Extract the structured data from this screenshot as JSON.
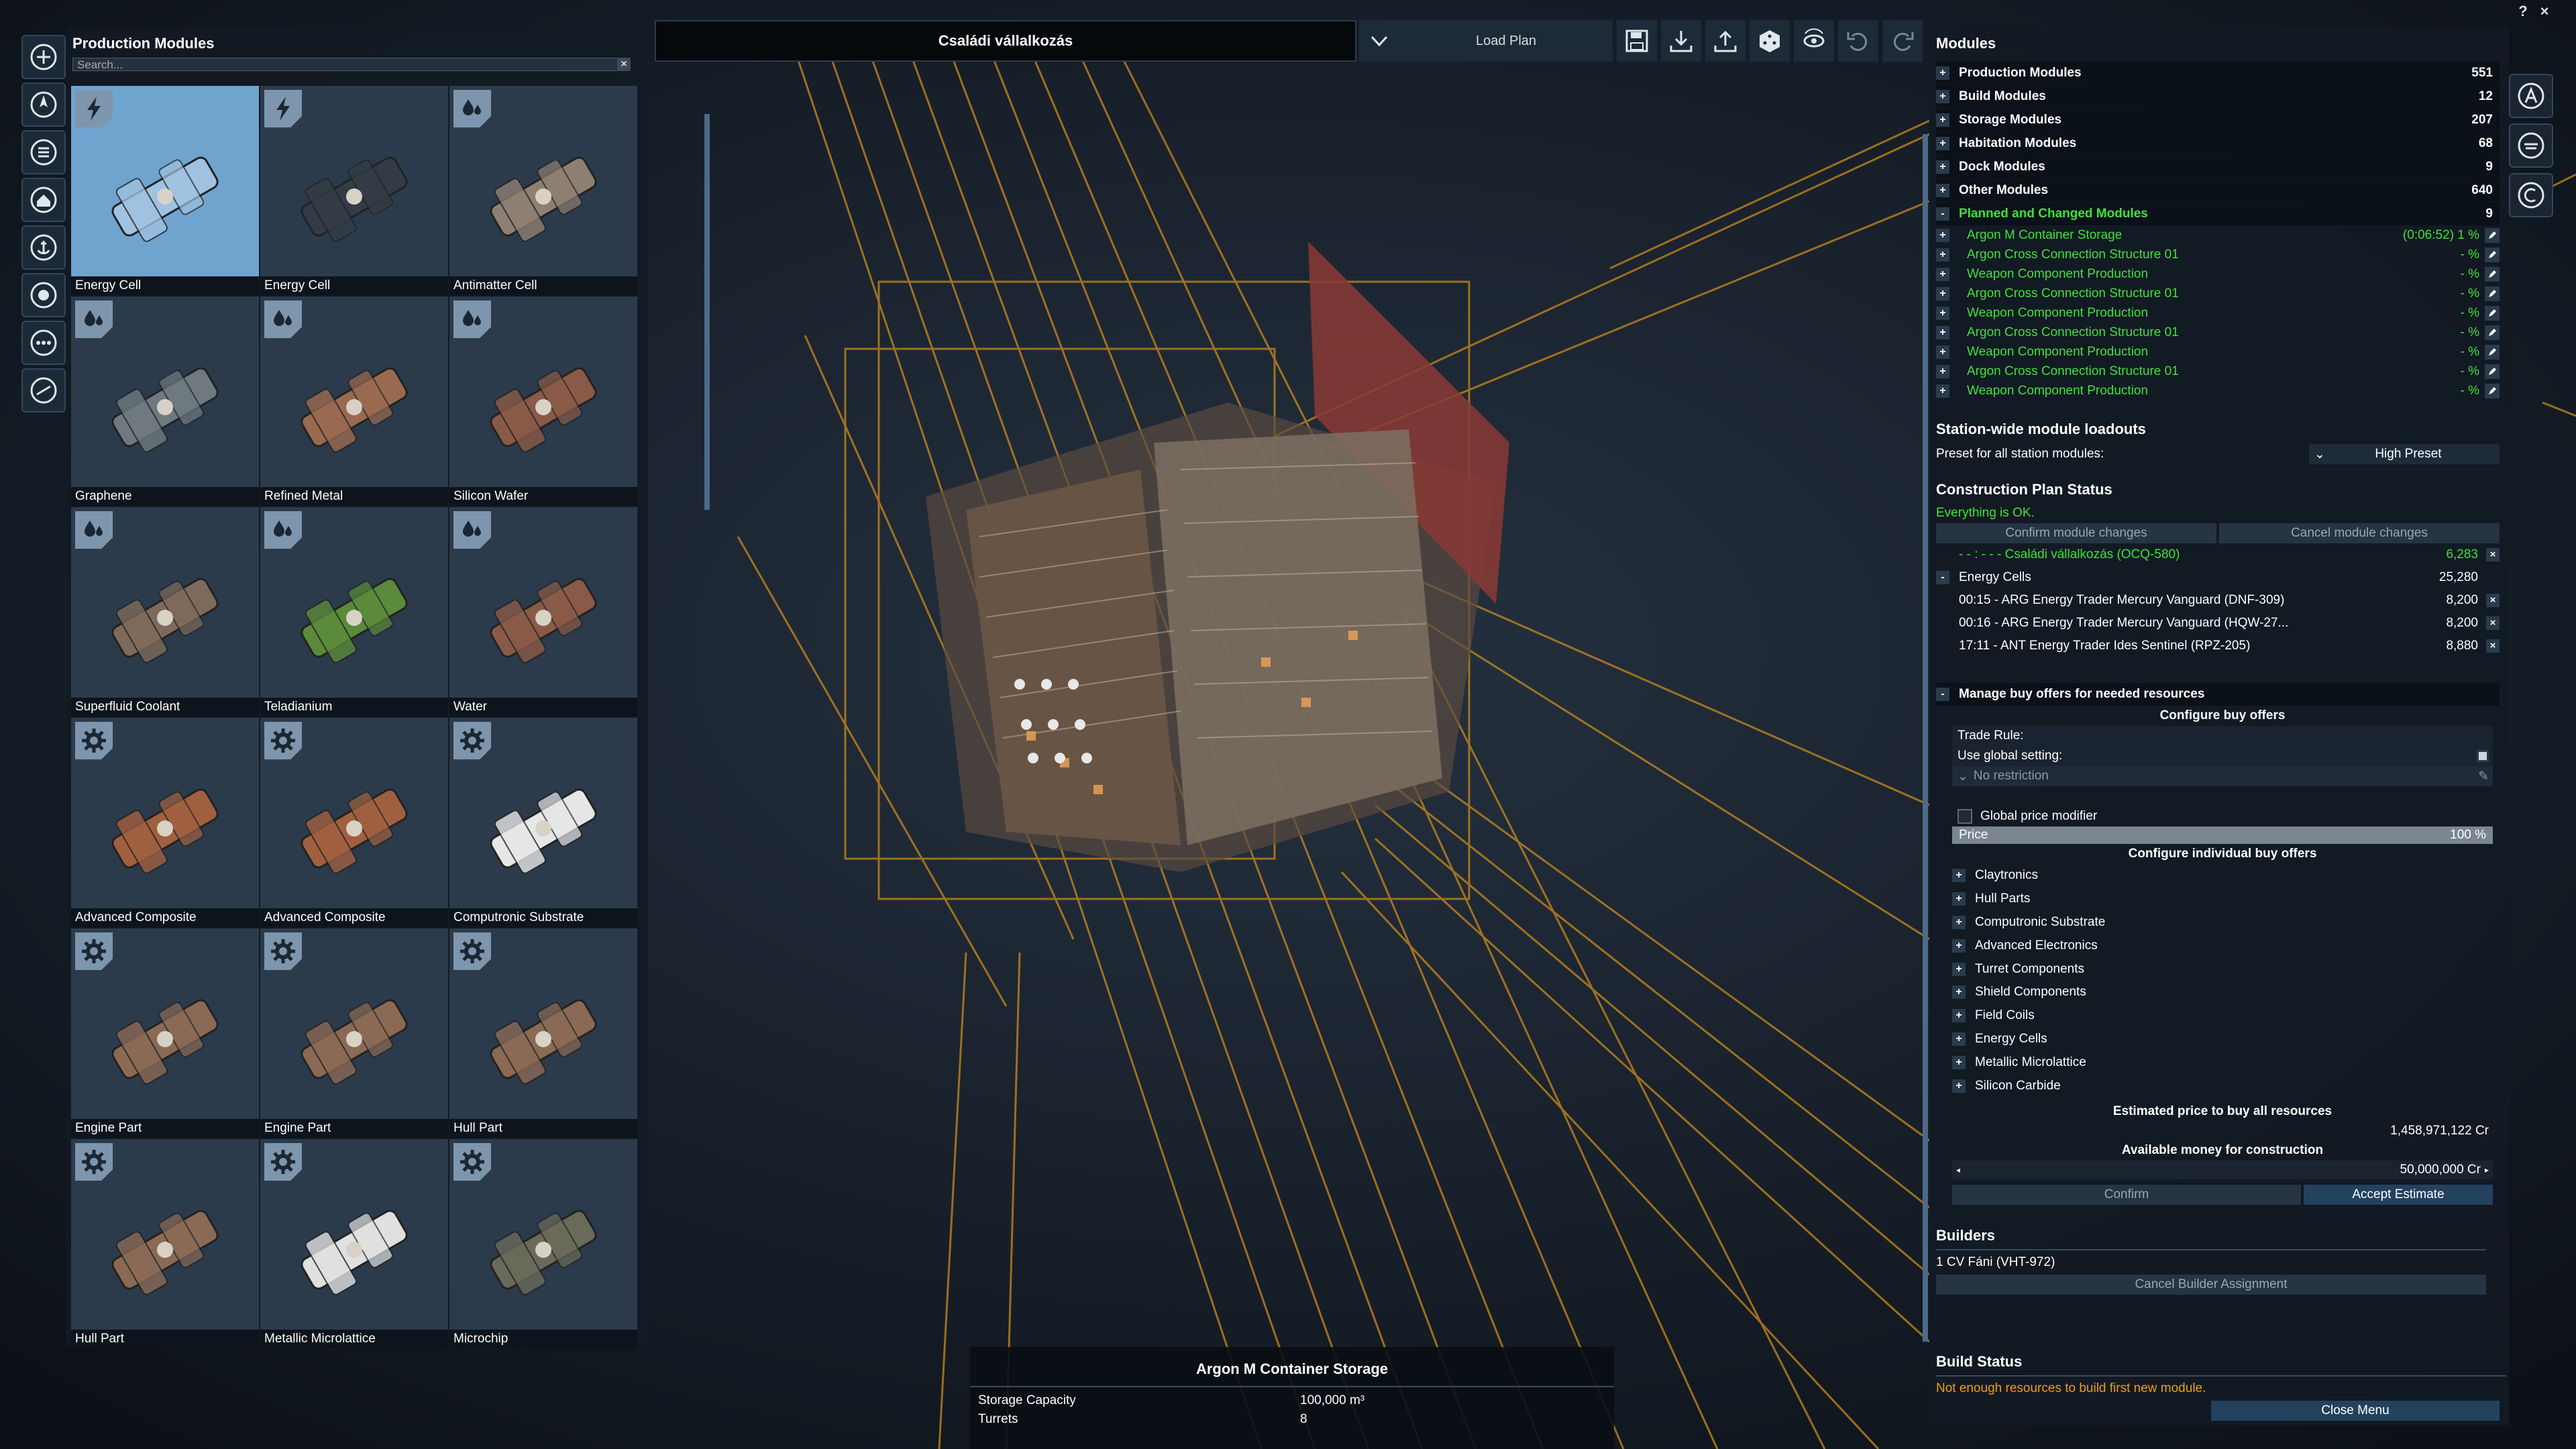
{
  "left_panel": {
    "title": "Production Modules",
    "search_placeholder": "Search...",
    "tiles": [
      {
        "label": "Energy Cell",
        "badge": "lightning-icon"
      },
      {
        "label": "Energy Cell",
        "badge": "lightning-icon"
      },
      {
        "label": "Antimatter Cell",
        "badge": "droplets-icon"
      },
      {
        "label": "Graphene",
        "badge": "droplets-icon"
      },
      {
        "label": "Refined Metal",
        "badge": "droplets-icon"
      },
      {
        "label": "Silicon Wafer",
        "badge": "droplets-icon"
      },
      {
        "label": "Superfluid Coolant",
        "badge": "droplets-icon"
      },
      {
        "label": "Teladianium",
        "badge": "droplets-icon"
      },
      {
        "label": "Water",
        "badge": "droplets-icon"
      },
      {
        "label": "Advanced Composite",
        "badge": "gear-icon"
      },
      {
        "label": "Advanced Composite",
        "badge": "gear-icon"
      },
      {
        "label": "Computronic Substrate",
        "badge": "gear-icon"
      },
      {
        "label": "Engine Part",
        "badge": "gear-icon"
      },
      {
        "label": "Engine Part",
        "badge": "gear-icon"
      },
      {
        "label": "Hull Part",
        "badge": "gear-icon"
      },
      {
        "label": "Hull Part",
        "badge": "gear-icon"
      },
      {
        "label": "Metallic Microlattice",
        "badge": "gear-icon"
      },
      {
        "label": "Microchip",
        "badge": "gear-icon"
      }
    ]
  },
  "top_bar": {
    "plan_name": "Családi vállalkozás",
    "load_plan": "Load Plan"
  },
  "modules": {
    "title": "Modules",
    "categories": [
      {
        "name": "Production Modules",
        "count": "551"
      },
      {
        "name": "Build Modules",
        "count": "12"
      },
      {
        "name": "Storage Modules",
        "count": "207"
      },
      {
        "name": "Habitation Modules",
        "count": "68"
      },
      {
        "name": "Dock Modules",
        "count": "9"
      },
      {
        "name": "Other Modules",
        "count": "640"
      }
    ],
    "planned": {
      "name": "Planned and Changed Modules",
      "count": "9"
    },
    "planned_items": [
      {
        "name": "Argon M Container Storage",
        "status": "(0:06:52)  1 %"
      },
      {
        "name": "Argon Cross Connection Structure 01",
        "status": "- %"
      },
      {
        "name": "Weapon Component Production",
        "status": "- %"
      },
      {
        "name": "Argon Cross Connection Structure 01",
        "status": "- %"
      },
      {
        "name": "Weapon Component Production",
        "status": "- %"
      },
      {
        "name": "Argon Cross Connection Structure 01",
        "status": "- %"
      },
      {
        "name": "Weapon Component Production",
        "status": "- %"
      },
      {
        "name": "Argon Cross Connection Structure 01",
        "status": "- %"
      },
      {
        "name": "Weapon Component Production",
        "status": "- %"
      }
    ]
  },
  "loadouts": {
    "title": "Station-wide module loadouts",
    "preset_label": "Preset for all station modules:",
    "preset_value": "High Preset"
  },
  "plan_status": {
    "title": "Construction Plan Status",
    "ok": "Everything is OK.",
    "confirm": "Confirm module changes",
    "cancel": "Cancel module changes",
    "station_line": "- - : - -  - Családi vállalkozás (OCQ-580)",
    "station_value": "6,283",
    "energy_cells": "Energy Cells",
    "energy_cells_value": "25,280",
    "trades": [
      {
        "text": "00:15 - ARG Energy Trader Mercury Vanguard (DNF-309)",
        "value": "8,200"
      },
      {
        "text": "00:16 - ARG Energy Trader Mercury Vanguard (HQW-27...",
        "value": "8,200"
      },
      {
        "text": "17:11 - ANT Energy Trader Ides Sentinel (RPZ-205)",
        "value": "8,880"
      }
    ]
  },
  "buy_offers": {
    "manage": "Manage buy offers for needed resources",
    "configure": "Configure buy offers",
    "trade_rule": "Trade Rule:",
    "use_global": "Use global setting:",
    "no_restriction": "No restriction",
    "global_price": "Global price modifier",
    "price_label": "Price",
    "price_value": "100 %",
    "configure_individual": "Configure individual buy offers",
    "resources": [
      "Claytronics",
      "Hull Parts",
      "Computronic Substrate",
      "Advanced Electronics",
      "Turret Components",
      "Shield Components",
      "Field Coils",
      "Energy Cells",
      "Metallic Microlattice",
      "Silicon Carbide"
    ],
    "estimated_label": "Estimated price to buy all resources",
    "estimated_value": "1,458,971,122 Cr",
    "available_label": "Available money for construction",
    "available_value": "50,000,000 Cr",
    "confirm": "Confirm",
    "accept": "Accept Estimate"
  },
  "builders": {
    "title": "Builders",
    "builder": "1 CV Fáni (VHT-972)",
    "cancel": "Cancel Builder Assignment"
  },
  "build_status": {
    "title": "Build Status",
    "message": "Not enough resources to build first new module.",
    "close": "Close Menu"
  },
  "info_box": {
    "title": "Argon M Container Storage",
    "storage_label": "Storage Capacity",
    "storage_value": "100,000 m³",
    "turrets_label": "Turrets",
    "turrets_value": "8"
  },
  "colors": {
    "accent": "#3fe23a",
    "warning": "#f0a000",
    "selected": "#6fa4cf",
    "wireframe": "#c98a1a"
  }
}
